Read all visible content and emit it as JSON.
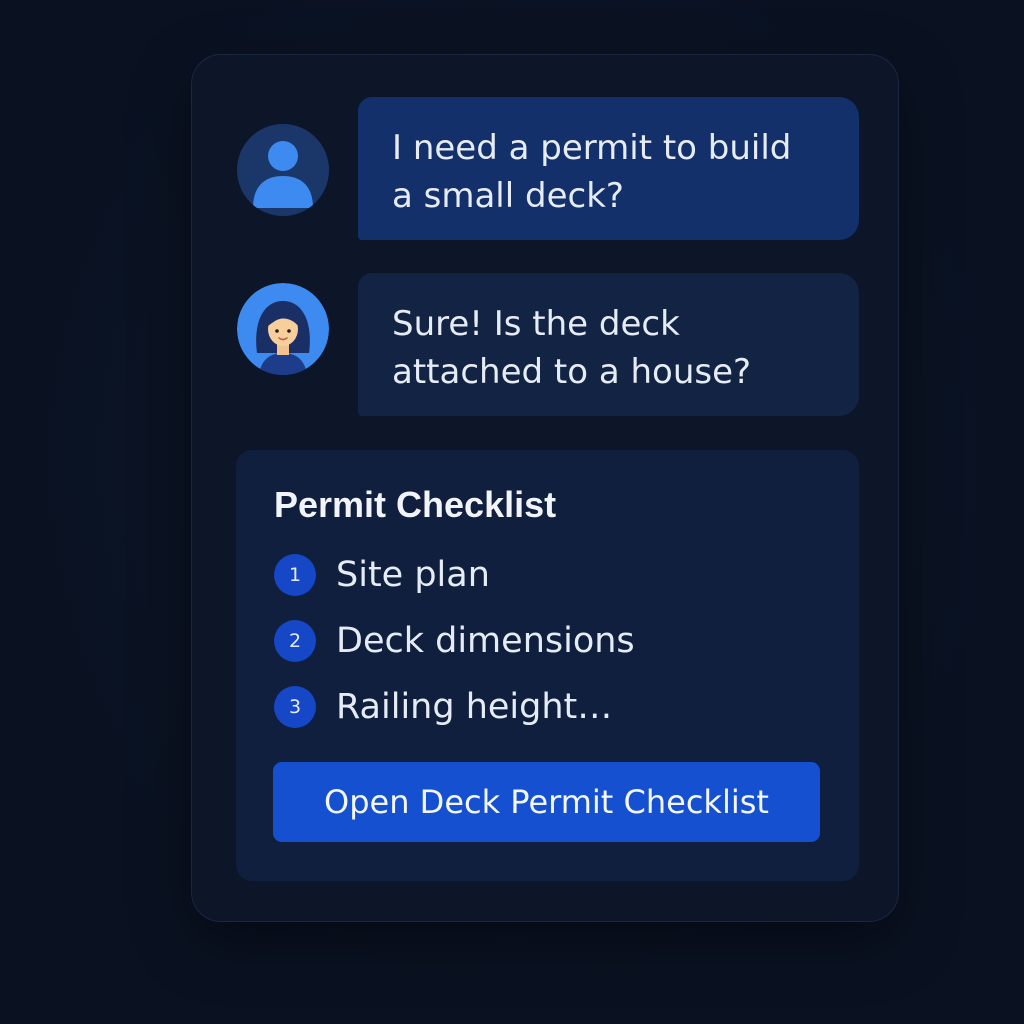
{
  "conversation": {
    "user_message": {
      "avatar_icon": "user-silhouette-icon",
      "text": "I need a permit to build\na small deck?"
    },
    "agent_message": {
      "avatar_icon": "assistant-woman-avatar-icon",
      "text": "Sure! Is the deck\nattached to a house?"
    }
  },
  "checklist": {
    "title": "Permit Checklist",
    "items": [
      {
        "number": "1",
        "label": "Site plan"
      },
      {
        "number": "2",
        "label": "Deck dimensions"
      },
      {
        "number": "3",
        "label": "Railing height…"
      }
    ],
    "button_label": "Open Deck Permit Checklist"
  },
  "colors": {
    "background": "#0a1222",
    "panel": "#0c1628",
    "user_bubble": "#13306b",
    "agent_bubble": "#132343",
    "checklist_card": "#101f3d",
    "accent_blue": "#1450cf",
    "avatar_blue": "#3d8bf0"
  }
}
